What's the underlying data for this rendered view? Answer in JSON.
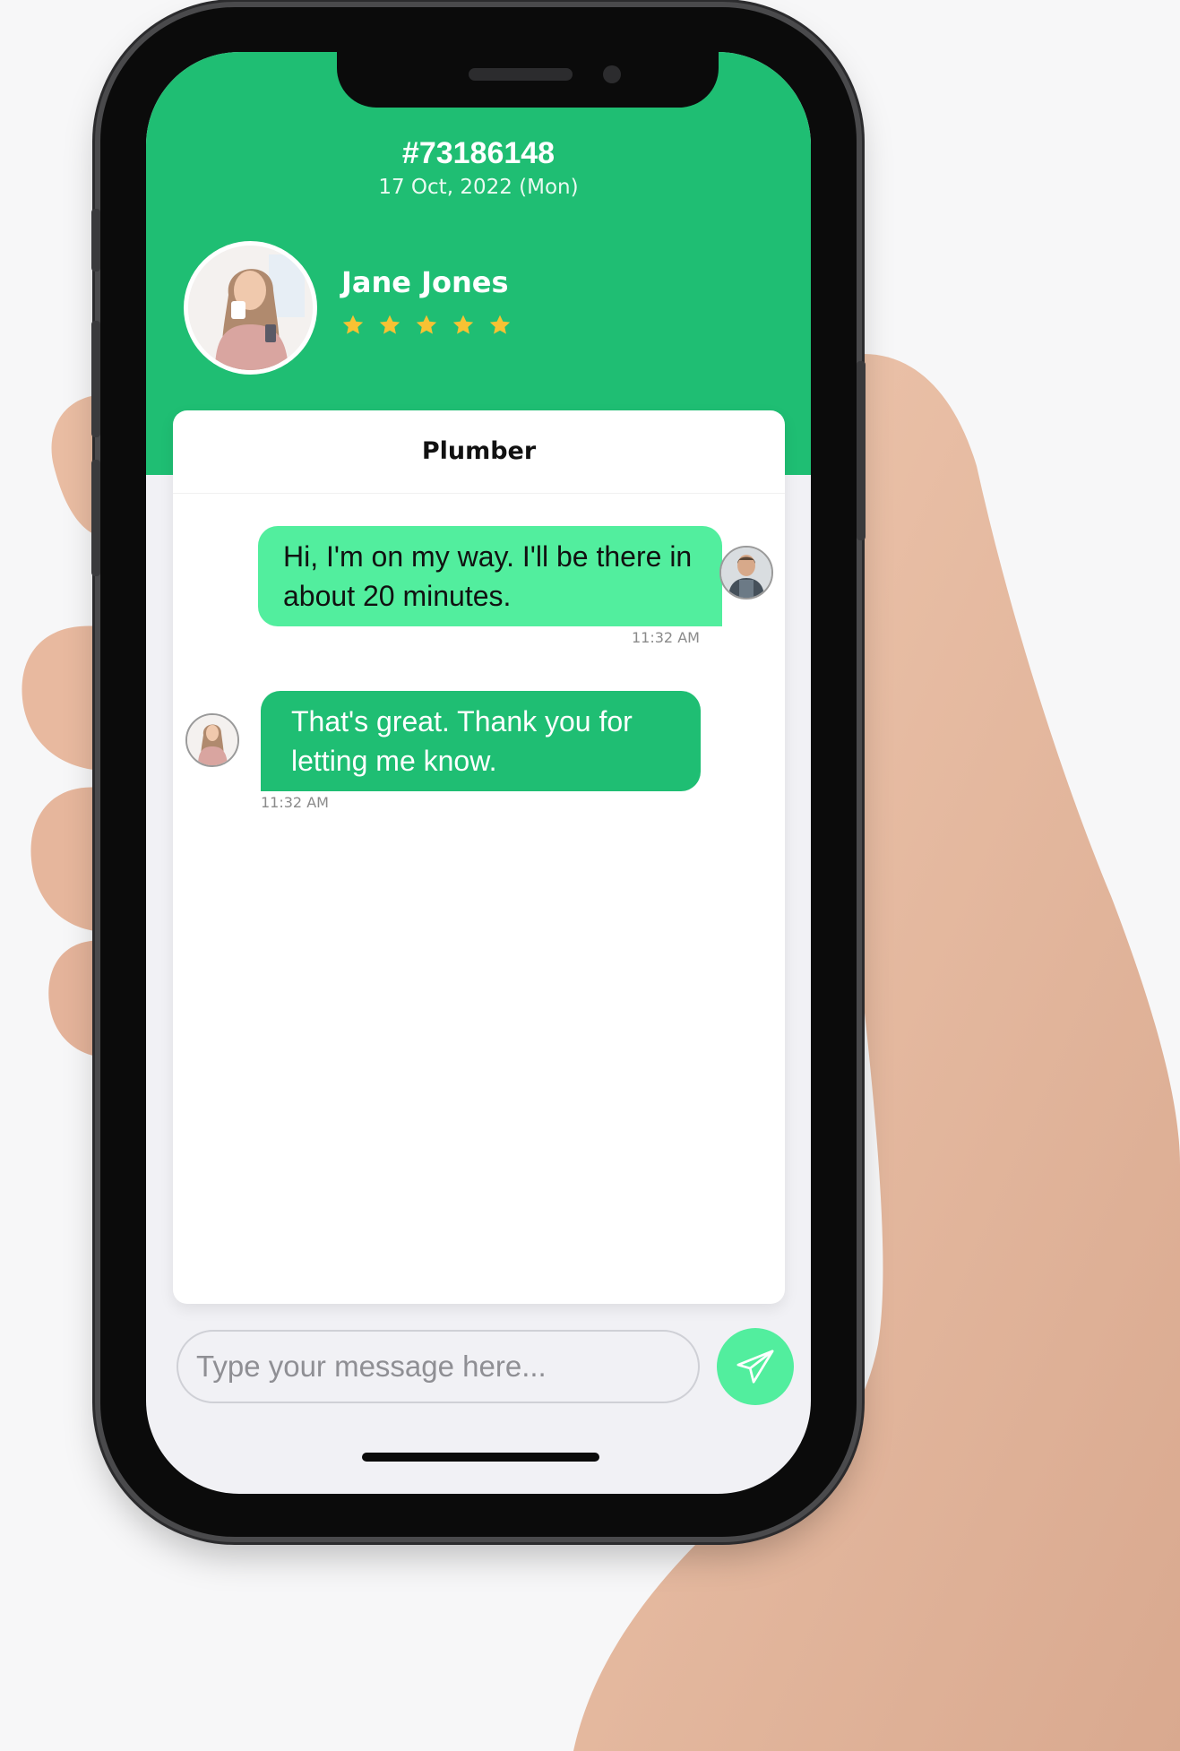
{
  "order": {
    "id": "#73186148",
    "date": "17 Oct, 2022 (Mon)"
  },
  "profile": {
    "name": "Jane Jones",
    "rating": 5,
    "rating_max": 5,
    "avatar_icon": "woman-with-mug-avatar"
  },
  "chat": {
    "title": "Plumber",
    "messages": [
      {
        "sender": "plumber",
        "text": "Hi, I'm on my way. I'll be there in about 20 minutes.",
        "time": "11:32 AM"
      },
      {
        "sender": "jane",
        "text": "That's great. Thank you for letting me know.",
        "time": "11:32 AM"
      }
    ]
  },
  "composer": {
    "placeholder": "Type your message here...",
    "send_icon": "paper-plane-icon"
  },
  "colors": {
    "brand_green": "#1fbe73",
    "light_green": "#52ee9e",
    "star_yellow": "#f7c233"
  }
}
